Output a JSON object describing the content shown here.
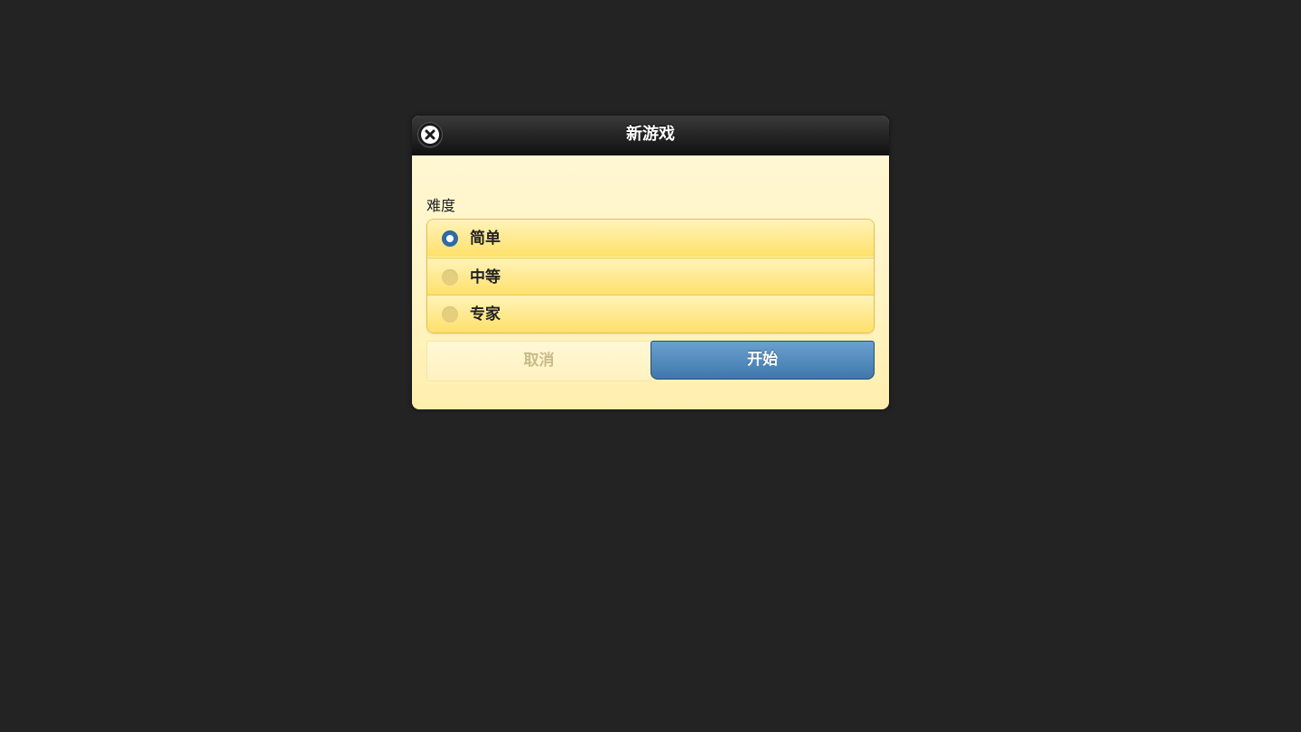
{
  "dialog": {
    "title": "新游戏",
    "close_icon": "close-icon"
  },
  "difficulty": {
    "label": "难度",
    "selected_index": 0,
    "options": [
      {
        "label": "简单",
        "selected": true
      },
      {
        "label": "中等",
        "selected": false
      },
      {
        "label": "专家",
        "selected": false
      }
    ]
  },
  "buttons": {
    "cancel_label": "取消",
    "cancel_disabled": true,
    "start_label": "开始"
  },
  "colors": {
    "background": "#232323",
    "dialog_body": "#fff4c4",
    "option_fill": "#ffe06a",
    "radio_checked": "#2f6aa8",
    "start_button": "#4f87bd"
  }
}
